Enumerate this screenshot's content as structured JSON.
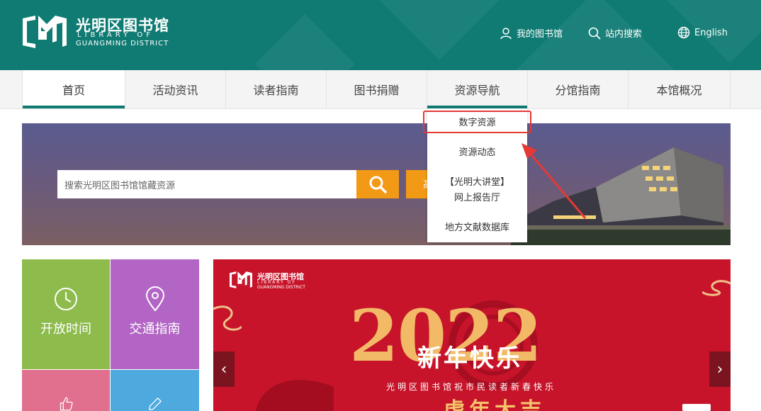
{
  "header": {
    "logo_cn": "光明区图书馆",
    "logo_en_line1": "LIBRARY OF",
    "logo_en_line2": "GUANGMING DISTRICT",
    "links": [
      {
        "icon": "user-icon",
        "label": "我的图书馆"
      },
      {
        "icon": "search-icon",
        "label": "站内搜索"
      },
      {
        "icon": "globe-icon",
        "label": "English"
      }
    ]
  },
  "nav": {
    "items": [
      "首页",
      "活动资讯",
      "读者指南",
      "图书捐赠",
      "资源导航",
      "分馆指南",
      "本馆概况"
    ],
    "active_index": 0
  },
  "search": {
    "placeholder": "搜索光明区图书馆馆藏资源",
    "advanced_label": "高"
  },
  "dropdown": {
    "items": [
      "数字资源",
      "资源动态",
      "【光明大讲堂】",
      "网上报告厅",
      "地方文献数据库"
    ],
    "highlighted_index": 0
  },
  "tiles": [
    {
      "icon": "clock-icon",
      "label": "开放时间",
      "color": "#8dbb4c"
    },
    {
      "icon": "location-pin-icon",
      "label": "交通指南",
      "color": "#b265c4"
    },
    {
      "icon": "thumbs-up-icon",
      "label": "",
      "color": "#e0708e"
    },
    {
      "icon": "pencil-icon",
      "label": "",
      "color": "#4ea9de"
    }
  ],
  "carousel": {
    "logo_cn": "光明区图书馆",
    "logo_en_line1": "LIBRARY OF",
    "logo_en_line2": "GUANGMING DISTRICT",
    "year": "2022",
    "title": "新年快乐",
    "subtitle": "光明区图书馆祝市民读者新春快乐",
    "bottom_text": "虎年大吉"
  },
  "colors": {
    "header_bg": "#0f7b73",
    "accent_orange": "#f29a16",
    "highlight_red": "#e53935",
    "carousel_red": "#c7142a"
  }
}
